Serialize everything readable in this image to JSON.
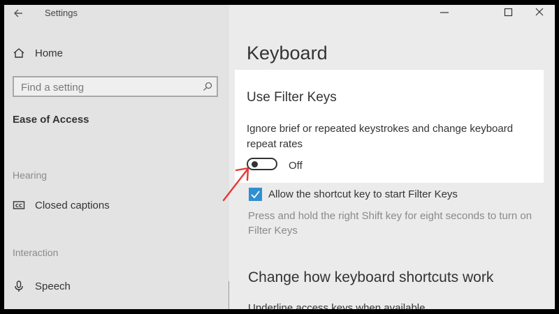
{
  "window": {
    "title": "Settings"
  },
  "sidebar": {
    "home_label": "Home",
    "search_placeholder": "Find a setting",
    "current_section": "Ease of Access",
    "groups": [
      {
        "heading": "Hearing",
        "items": [
          {
            "label": "Closed captions",
            "icon": "closed-captions-icon"
          }
        ]
      },
      {
        "heading": "Interaction",
        "items": [
          {
            "label": "Speech",
            "icon": "microphone-icon"
          }
        ]
      }
    ]
  },
  "main": {
    "page_title": "Keyboard",
    "filter_keys": {
      "heading": "Use Filter Keys",
      "description": "Ignore brief or repeated keystrokes and change keyboard repeat rates",
      "toggle_state": "Off",
      "toggle_on": false
    },
    "shortcut_checkbox": {
      "label": "Allow the shortcut key to start Filter Keys",
      "checked": true
    },
    "shortcut_hint": "Press and hold the right Shift key for eight seconds to turn on Filter Keys",
    "section2_heading": "Change how keyboard shortcuts work",
    "underline_label": "Underline access keys when available"
  },
  "colors": {
    "accent": "#2f8fd0",
    "annotation_arrow": "#e53935"
  }
}
